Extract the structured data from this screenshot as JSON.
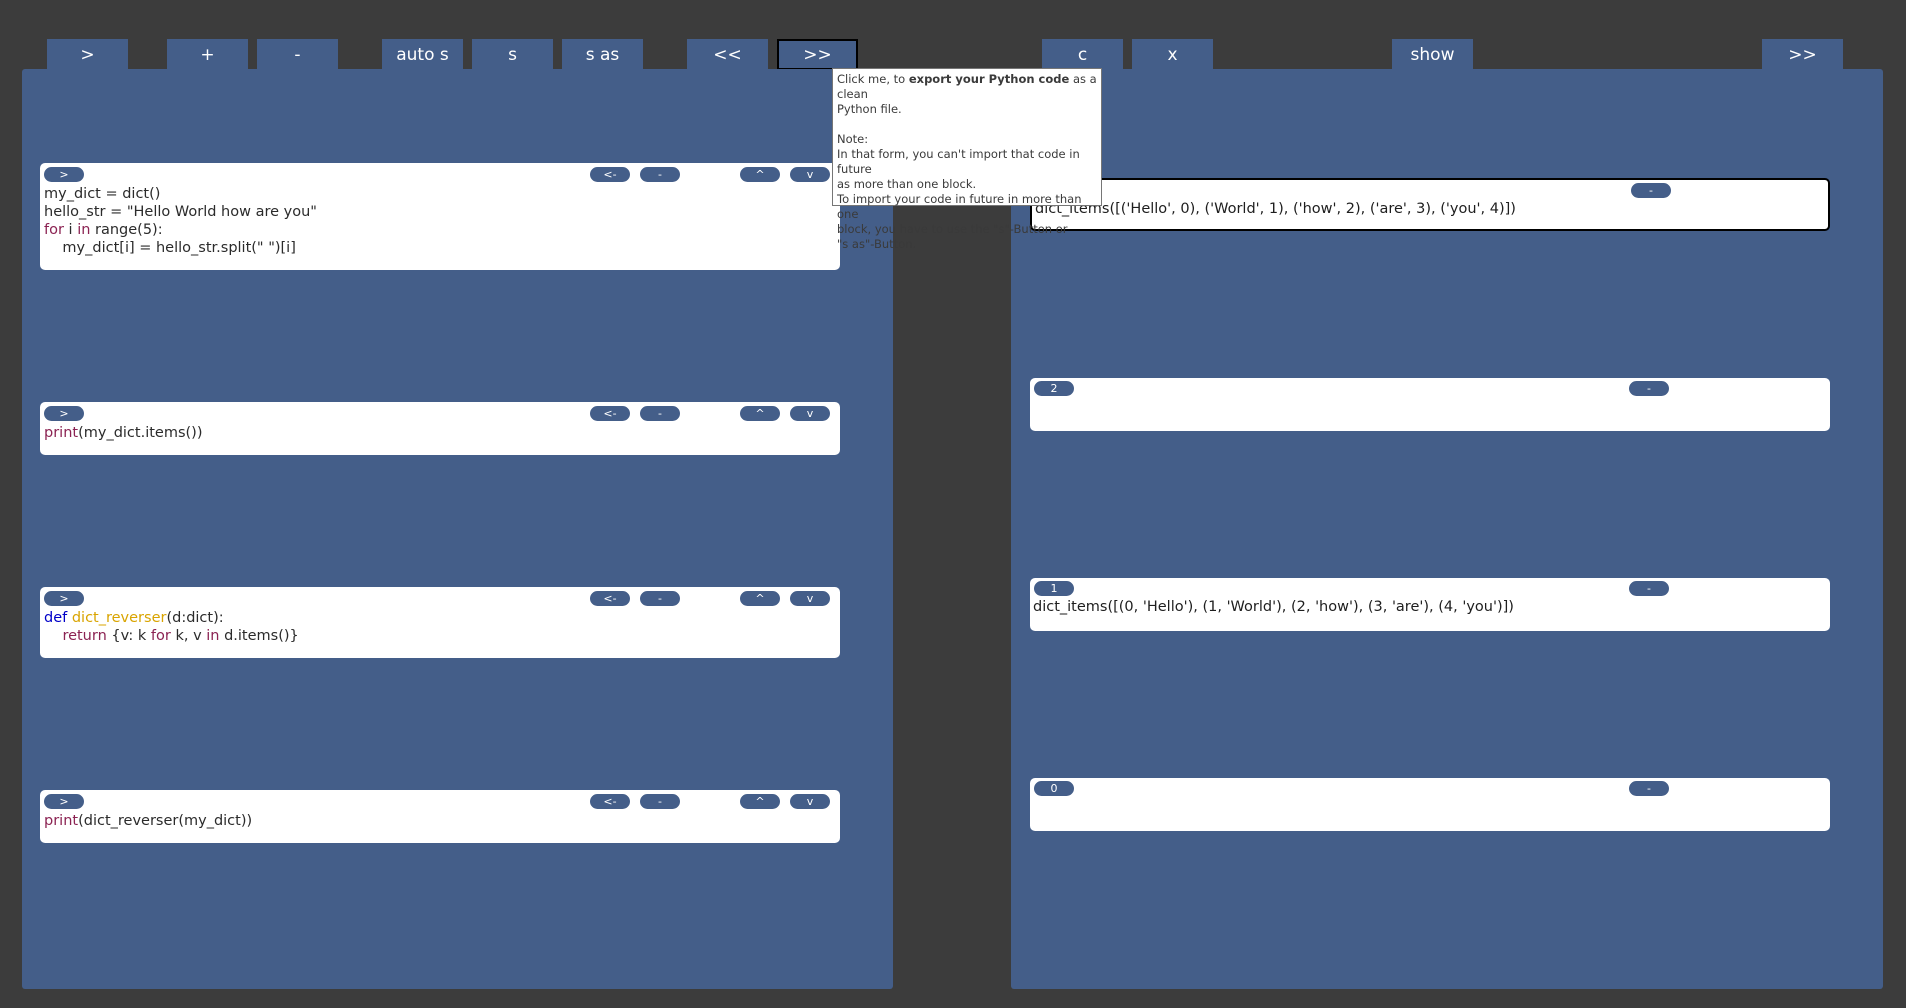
{
  "toolbar": {
    "run": ">",
    "add": "+",
    "remove": "-",
    "auto_save": "auto s",
    "save": "s",
    "save_as": "s as",
    "import": "<<",
    "export": ">>",
    "clear": "c",
    "close": "x",
    "show": "show",
    "expand": ">>"
  },
  "cell_buttons": {
    "run": ">",
    "back": "<-",
    "delete": "-",
    "up": "^",
    "down": "v"
  },
  "cells": [
    {
      "lines": [
        [
          {
            "t": "my_dict = dict()"
          }
        ],
        [
          {
            "t": "hello_str = \"Hello World how are you\""
          }
        ],
        [
          {
            "t": "for",
            "c": "kw2"
          },
          {
            "t": " i "
          },
          {
            "t": "in",
            "c": "kw2"
          },
          {
            "t": " range(5):"
          }
        ],
        [
          {
            "t": "    my_dict[i] = hello_str.split(\" \")[i]"
          }
        ]
      ]
    },
    {
      "lines": [
        [
          {
            "t": "print",
            "c": "kw2"
          },
          {
            "t": "(my_dict.items())"
          }
        ]
      ]
    },
    {
      "lines": [
        [
          {
            "t": "def",
            "c": "kw"
          },
          {
            "t": " "
          },
          {
            "t": "dict_reverser",
            "c": "fn"
          },
          {
            "t": "(d:dict):"
          }
        ],
        [
          {
            "t": "    "
          },
          {
            "t": "return",
            "c": "kw2"
          },
          {
            "t": " {v: k "
          },
          {
            "t": "for",
            "c": "kw2"
          },
          {
            "t": " k, v "
          },
          {
            "t": "in",
            "c": "kw2"
          },
          {
            "t": " d.items()}"
          }
        ]
      ]
    },
    {
      "lines": [
        [
          {
            "t": "print",
            "c": "kw2"
          },
          {
            "t": "(dict_reverser(my_dict))"
          }
        ]
      ]
    }
  ],
  "outputs": [
    {
      "index": "",
      "delete": "-",
      "text": "dict_items([('Hello', 0), ('World', 1), ('how', 2), ('are', 3), ('you', 4)])"
    },
    {
      "index": "2",
      "delete": "-",
      "text": ""
    },
    {
      "index": "1",
      "delete": "-",
      "text": "dict_items([(0, 'Hello'), (1, 'World'), (2, 'how'), (3, 'are'), (4, 'you')])"
    },
    {
      "index": "0",
      "delete": "-",
      "text": ""
    }
  ],
  "tooltip": {
    "line1_pre": "Click me, to ",
    "line1_bold": "export your Python code",
    "line1_post": " as a clean",
    "line2": "Python file.",
    "note_title": "Note:",
    "note_1": "In that form, you can't import that code in future",
    "note_2": "as more than one block.",
    "note_3": "To import your code in future in more than one",
    "note_4": "block, you have to use the \"s\"-Button or",
    "note_5": "\"s as\"-Button."
  },
  "colors": {
    "background": "#3c3c3c",
    "panel": "#445e89",
    "cell": "#ffffff",
    "keyword_blue": "#0000c8",
    "keyword_purple": "#8b2252",
    "function_name": "#d9a400"
  }
}
